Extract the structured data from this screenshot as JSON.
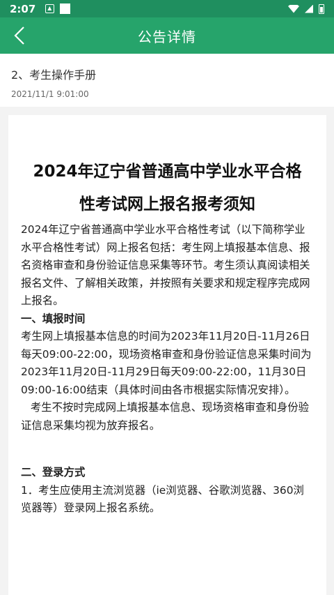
{
  "status_bar": {
    "time": "2:07"
  },
  "app_bar": {
    "title": "公告详情"
  },
  "notice": {
    "title": "2、考生操作手册",
    "date": "2021/11/1 9:01:00"
  },
  "document": {
    "heading_line1": "2024年辽宁省普通高中学业水平合格",
    "heading_line2": "性考试网上报名报考须知",
    "intro": "2024年辽宁省普通高中学业水平合格性考试（以下简称学业水平合格性考试）网上报名包括：考生网上填报基本信息、报名资格审查和身份验证信息采集等环节。考生须认真阅读相关报名文件、了解相关政策，并按照有关要求和规定程序完成网上报名。",
    "section1_title": "一、填报时间",
    "section1_p1": "考生网上填报基本信息的时间为2023年11月20日-11月26日每天09:00-22:00，现场资格审查和身份验证信息采集时间为2023年11月20日-11月29日每天09:00-22:00，11月30日09:00-16:00结束（具体时间由各市根据实际情况安排）。",
    "section1_p2": "考生不按时完成网上填报基本信息、现场资格审查和身份验证信息采集均视为放弃报名。",
    "section2_title": "二、登录方式",
    "section2_p1": "1．考生应使用主流浏览器（ie浏览器、谷歌浏览器、360浏览器等）登录网上报名系统。"
  },
  "colors": {
    "status_bar": "#1f8f5f",
    "app_bar": "#26a46b",
    "background": "#f3f3f3"
  }
}
